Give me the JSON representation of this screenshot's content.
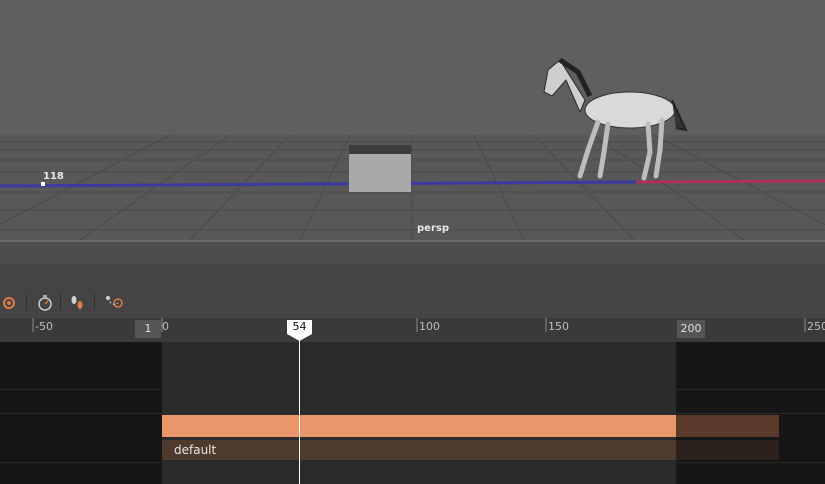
{
  "viewport": {
    "camera_label": "persp",
    "frame_counter": "118",
    "colors": {
      "background": "#5e5e5e",
      "grid": "#4a4a4a",
      "x_axis": "#b0305a",
      "z_axis": "#3a3aa0"
    }
  },
  "toolbar": {
    "icons": [
      "record-icon",
      "stopwatch-icon",
      "footprint-icon",
      "path-icon"
    ]
  },
  "timeline": {
    "tick_labels": [
      "-50",
      "0",
      "100",
      "150",
      "250"
    ],
    "range_start": "1",
    "range_end": "200",
    "current_frame": "54",
    "clip_name": "default",
    "colors": {
      "clip": "#e8966a",
      "clip_dark": "#5a3a2a",
      "playhead": "#ffffff"
    }
  }
}
